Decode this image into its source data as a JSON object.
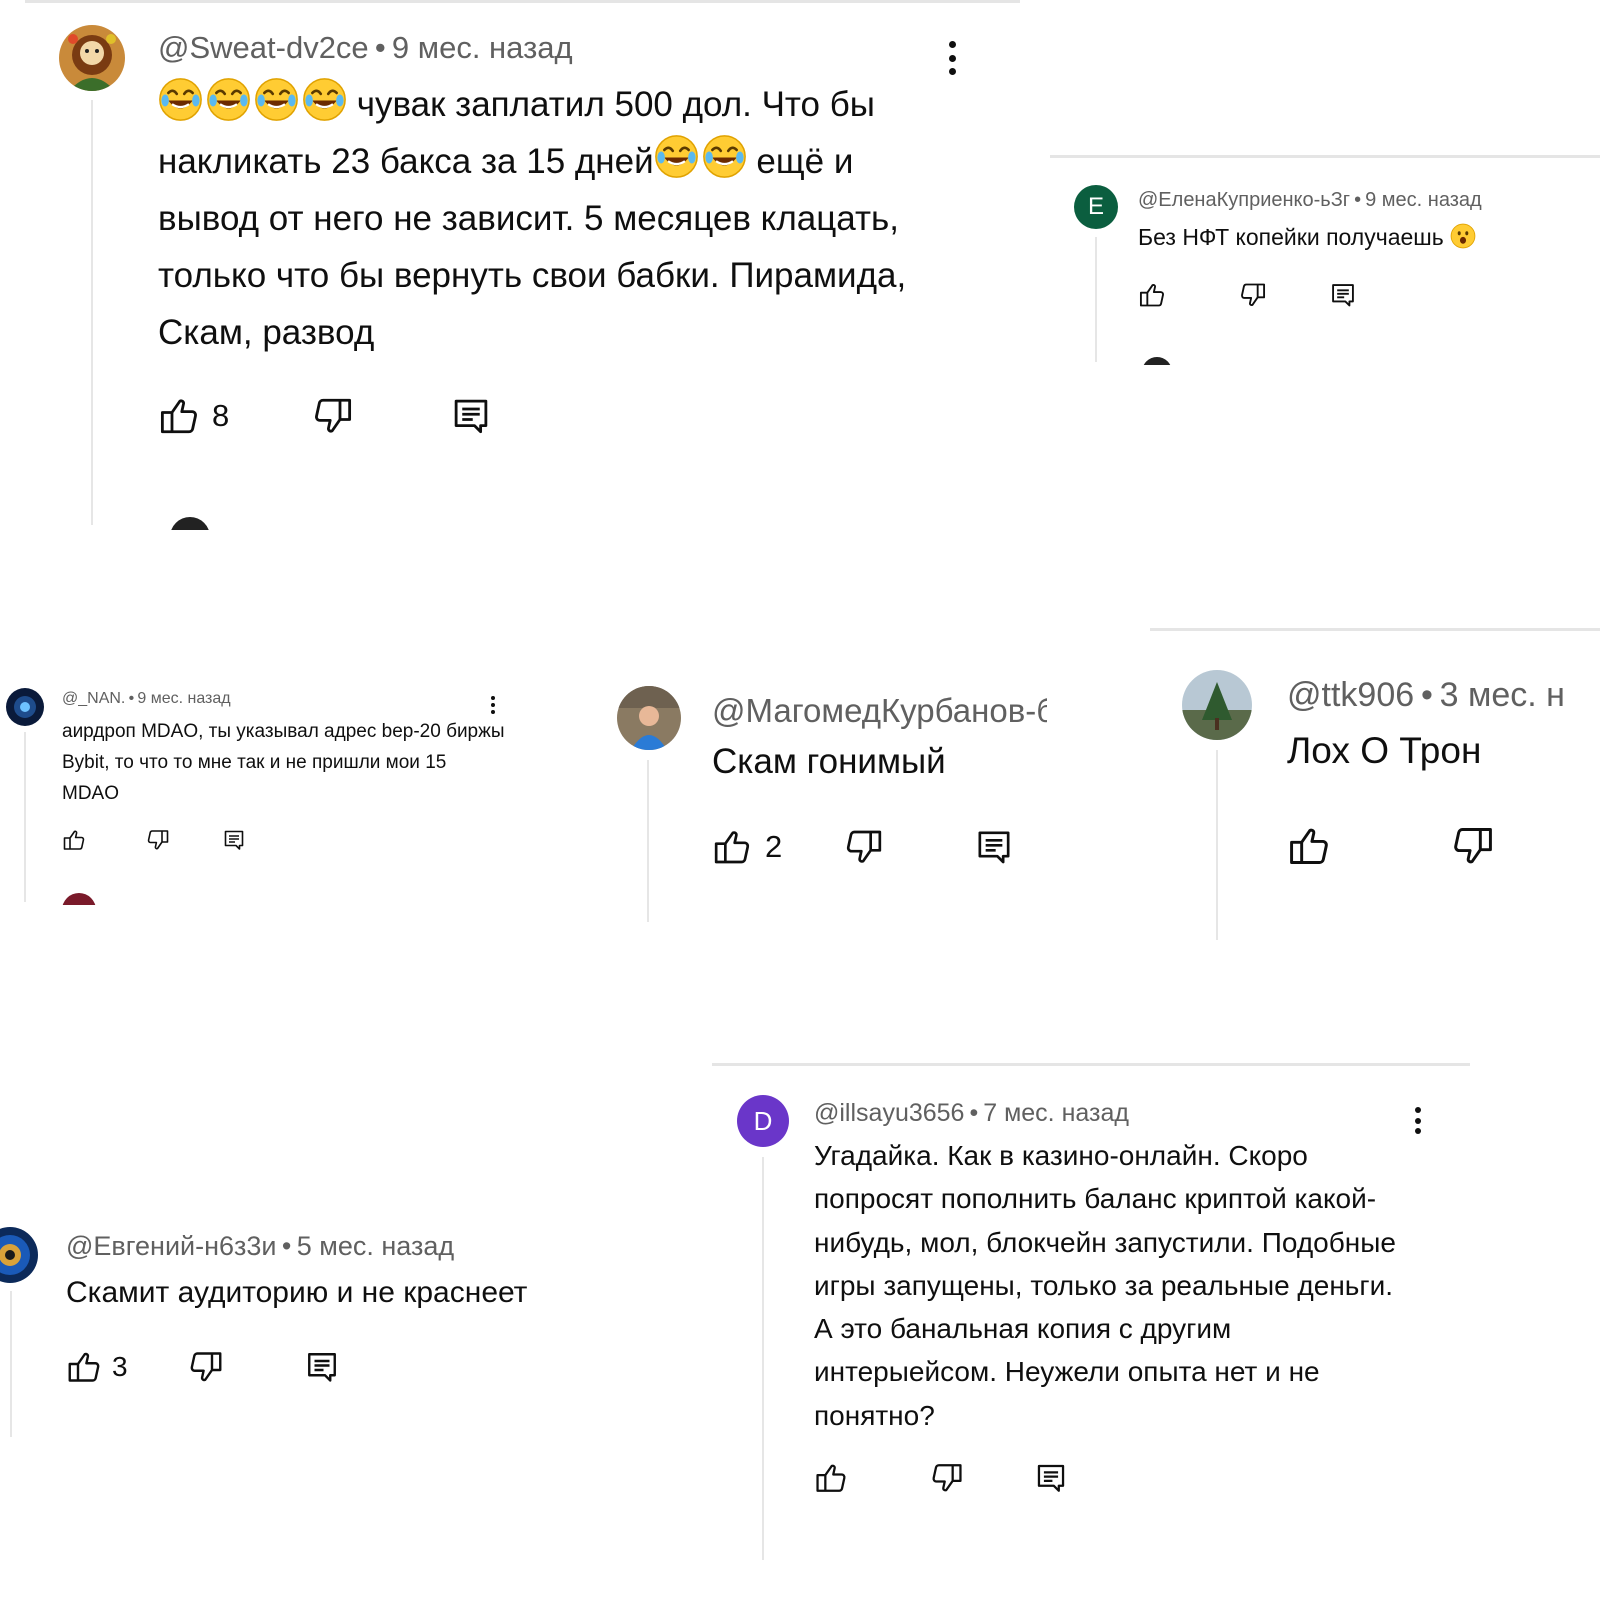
{
  "icons": {
    "like": "thumb-up-icon",
    "dislike": "thumb-down-icon",
    "reply": "reply-comment-icon",
    "more": "more-vertical-icon",
    "laugh": "tears-of-joy-emoji",
    "surprised": "surprised-face-emoji"
  },
  "colors": {
    "text": "#0f0f0f",
    "meta": "#606060",
    "avatar_e": "#0b5e3f",
    "avatar_d": "#6a36c9"
  },
  "comments": [
    {
      "author": "@Sweat-dv2ce",
      "age": "9 мес. назад",
      "text_parts": [
        "чувак заплатил 500 дол. Что бы накликать 23 бакса за 15 дней",
        "ещё и вывод от него не зависит. 5 месяцев клацать, только что бы вернуть свои бабки. Пирамида, Скам, развод"
      ],
      "likes": "8"
    },
    {
      "avatar_letter": "E",
      "author": "@ЕленаКуприенко-ьЗг",
      "age": "9 мес. назад",
      "text": "Без НФТ копейки получаешь",
      "likes": ""
    },
    {
      "author": "@_NAN.",
      "age": "9 мес. назад",
      "text": "аирдроп MDAO, ты указывал адрес bep-20 биржы Bybit, то что то мне так и не пришли мои 15 MDAO",
      "likes": ""
    },
    {
      "author": "@МагомедКурбанов-б",
      "text": "Скам гонимый",
      "likes": "2"
    },
    {
      "author": "@ttk906",
      "age": "3 мес. н",
      "text": "Лох О Трон",
      "likes": ""
    },
    {
      "author": "@Евгений-н6з3и",
      "age": "5 мес. назад",
      "text": "Скамит аудиторию и не краснеет",
      "likes": "3"
    },
    {
      "avatar_letter": "D",
      "author": "@illsayu3656",
      "age": "7 мес. назад",
      "text": "Угадайка. Как в казино-онлайн. Скоро попросят пополнить баланс криптой какой-нибудь, мол, блокчейн запустили. Подобные игры запущены, только за реальные деньги. А это банальная копия с другим интерыейсом. Неужели опыта нет и не понятно?",
      "likes": ""
    }
  ]
}
